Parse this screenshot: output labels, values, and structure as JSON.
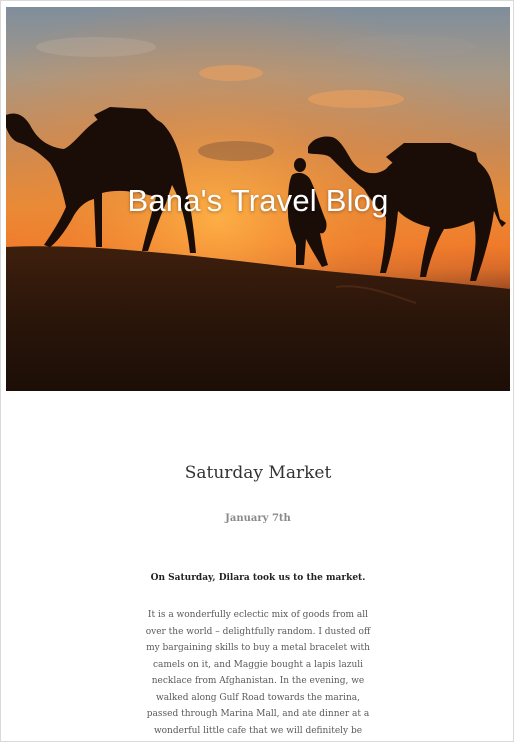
{
  "blog": {
    "title": "Bana's Travel Blog"
  },
  "post": {
    "title": "Saturday Market",
    "date": "January 7th",
    "lead": "On Saturday, Dilara took us to the market.",
    "body": "It is a wonderfully eclectic mix of goods from all over the world – delightfully random. I dusted off my bargaining skills to buy a metal bracelet with camels on it, and Maggie bought a lapis lazuli necklace from Afghanistan. In the evening, we walked along Gulf Road towards the marina, passed through Marina Mall, and ate dinner at a wonderful little cafe that we will definitely be frequenting. I’ve developed a slight obsession with lentil soul... maybe it’s because I miss"
  },
  "colors": {
    "title_text": "#333333",
    "date_text": "#8a8a8a",
    "body_text": "#5a5a5a"
  }
}
